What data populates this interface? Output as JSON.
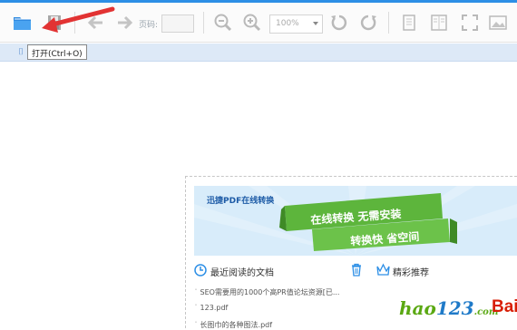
{
  "toolbar": {
    "page_label": "页码:",
    "page_value": "",
    "zoom_value": "100%"
  },
  "tooltip": {
    "text": "打开(Ctrl+O)"
  },
  "start_panel": {
    "banner_title": "迅捷PDF在线转换",
    "ribbon_top": "在线转换 无需安装",
    "ribbon_bottom": "转换快 省空间",
    "recent_label": "最近阅读的文档",
    "featured_label": "精彩推荐",
    "recent_files": [
      "SEO需要用的1000个高PR值论坛资源[已...",
      "123.pdf",
      "长图巾的各种图法.pdf"
    ]
  },
  "watermark": {
    "hao": "hao",
    "num": "123",
    "suffix": ".com",
    "bai": "Bai"
  },
  "colors": {
    "accent": "#2d8fe6",
    "arrow": "#e23333",
    "ribbon": "#5db53c",
    "tabstrip": "#dde9f7"
  }
}
